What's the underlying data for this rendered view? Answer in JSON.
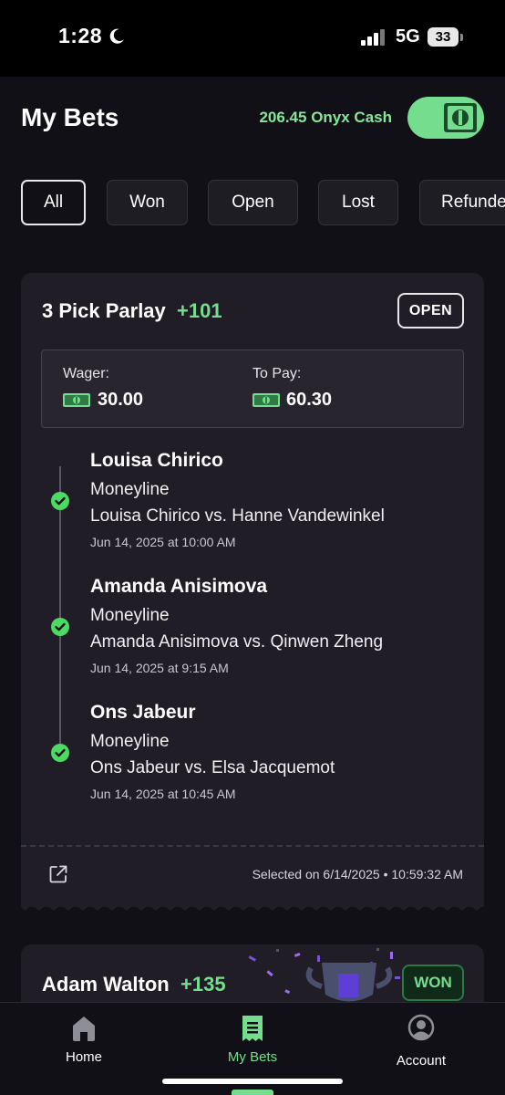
{
  "status_bar": {
    "time": "1:28",
    "network": "5G",
    "battery": "33"
  },
  "header": {
    "title": "My Bets",
    "cash_label": "206.45 Onyx Cash"
  },
  "filters": [
    {
      "label": "All",
      "active": true
    },
    {
      "label": "Won",
      "active": false
    },
    {
      "label": "Open",
      "active": false
    },
    {
      "label": "Lost",
      "active": false
    },
    {
      "label": "Refunde",
      "active": false
    }
  ],
  "bet": {
    "title": "3 Pick Parlay",
    "odds": "+101",
    "status": "OPEN",
    "wager_label": "Wager:",
    "wager_amount": "30.00",
    "to_pay_label": "To Pay:",
    "to_pay_amount": "60.30",
    "legs": [
      {
        "name": "Louisa Chirico",
        "market": "Moneyline",
        "match": "Louisa Chirico vs. Hanne Vandewinkel",
        "date": "Jun 14, 2025 at 10:00 AM"
      },
      {
        "name": "Amanda Anisimova",
        "market": "Moneyline",
        "match": "Amanda Anisimova vs. Qinwen Zheng",
        "date": "Jun 14, 2025 at 9:15 AM"
      },
      {
        "name": "Ons Jabeur",
        "market": "Moneyline",
        "match": "Ons Jabeur vs. Elsa Jacquemot",
        "date": "Jun 14, 2025 at 10:45 AM"
      }
    ],
    "selected_on": "Selected on 6/14/2025 • 10:59:32 AM"
  },
  "bet2": {
    "title": "Adam Walton",
    "odds": "+135",
    "status": "WON"
  },
  "nav": [
    {
      "label": "Home",
      "icon": "home-icon"
    },
    {
      "label": "My Bets",
      "icon": "receipt-icon"
    },
    {
      "label": "Account",
      "icon": "account-icon"
    }
  ],
  "colors": {
    "accent_green": "#75de8e",
    "background": "#111016",
    "card": "#201d26"
  }
}
